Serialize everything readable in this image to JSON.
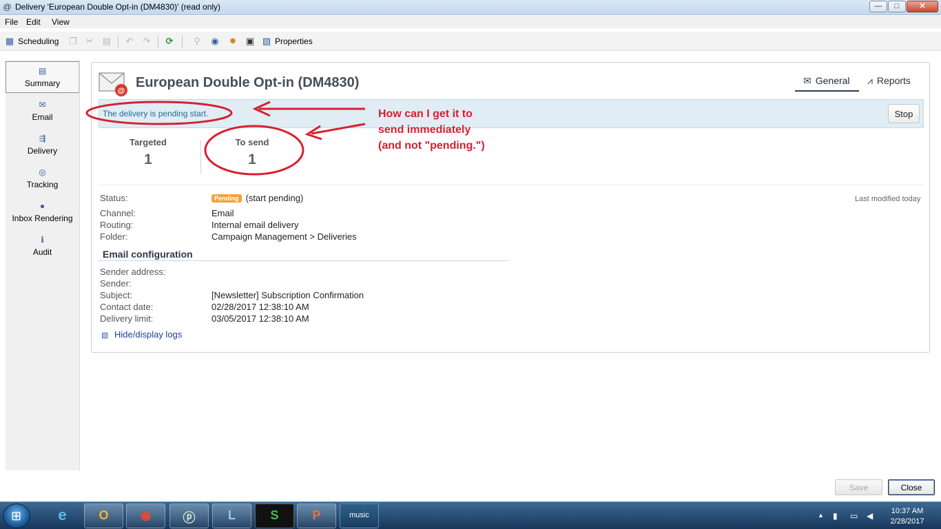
{
  "window": {
    "title": "Delivery 'European Double Opt-in (DM4830)' (read only)",
    "controls": {
      "minimize": "—",
      "maximize": "□",
      "close": "✕"
    }
  },
  "menu": [
    "File",
    "Edit",
    "View"
  ],
  "toolbar": {
    "scheduling_label": "Scheduling",
    "properties_label": "Properties",
    "icons": [
      "calendar-icon",
      "copy-icon",
      "cut-icon",
      "paste-icon",
      "undo-icon",
      "redo-icon",
      "refresh-icon",
      "attachment-icon",
      "network-icon",
      "settings-icon",
      "window-icon",
      "properties-icon"
    ]
  },
  "sidebar": {
    "items": [
      {
        "label": "Summary",
        "icon": "summary-icon",
        "active": true
      },
      {
        "label": "Email",
        "icon": "email-icon",
        "active": false
      },
      {
        "label": "Delivery",
        "icon": "delivery-icon",
        "active": false
      },
      {
        "label": "Tracking",
        "icon": "tracking-icon",
        "active": false
      },
      {
        "label": "Inbox Rendering",
        "icon": "inbox-rendering-icon",
        "active": false
      },
      {
        "label": "Audit",
        "icon": "audit-icon",
        "active": false
      }
    ]
  },
  "header": {
    "title": "European Double Opt-in (DM4830)",
    "tabs": [
      {
        "label": "General",
        "icon": "envelope-icon",
        "active": true
      },
      {
        "label": "Reports",
        "icon": "chart-line-icon",
        "active": false
      }
    ]
  },
  "banner": {
    "message": "The delivery is pending start.",
    "stop_label": "Stop"
  },
  "kpis": {
    "targeted_label": "Targeted",
    "targeted_value": "1",
    "to_send_label": "To send",
    "to_send_value": "1"
  },
  "details": {
    "status_label": "Status:",
    "status_badge": "Pending",
    "status_text": "(start pending)",
    "channel_label": "Channel:",
    "channel_value": "Email",
    "routing_label": "Routing:",
    "routing_value": "Internal email delivery",
    "folder_label": "Folder:",
    "folder_value": "Campaign Management > Deliveries",
    "last_modified": "Last modified today"
  },
  "email_config": {
    "section_title": "Email configuration",
    "sender_address_label": "Sender address:",
    "sender_label": "Sender:",
    "subject_label": "Subject:",
    "subject_value": "[Newsletter] Subscription Confirmation",
    "contact_date_label": "Contact date:",
    "contact_date_value": "02/28/2017 12:38:10 AM",
    "delivery_limit_label": "Delivery limit:",
    "delivery_limit_value": "03/05/2017 12:38:10 AM",
    "logs_link": "Hide/display logs"
  },
  "annotation": {
    "lines": [
      "How can I get it to",
      "send immediately",
      "(and not \"pending.\")"
    ],
    "color": "#d8202f"
  },
  "footer": {
    "save_label": "Save",
    "close_label": "Close"
  },
  "taskbar": {
    "apps": [
      "internet-explorer-icon",
      "outlook-icon",
      "chrome-icon",
      "app-p-icon",
      "lync-icon",
      "app-s-icon",
      "powerpoint-icon",
      "amazon-music-icon"
    ],
    "music_label": "music",
    "clock_time": "10:37 AM",
    "clock_date": "2/28/2017"
  },
  "colors": {
    "accent": "#2a3b58",
    "banner_bg": "#e0edf5",
    "banner_text": "#1f6c8c",
    "badge_pending": "#f1a23a",
    "link": "#1f3f98"
  }
}
